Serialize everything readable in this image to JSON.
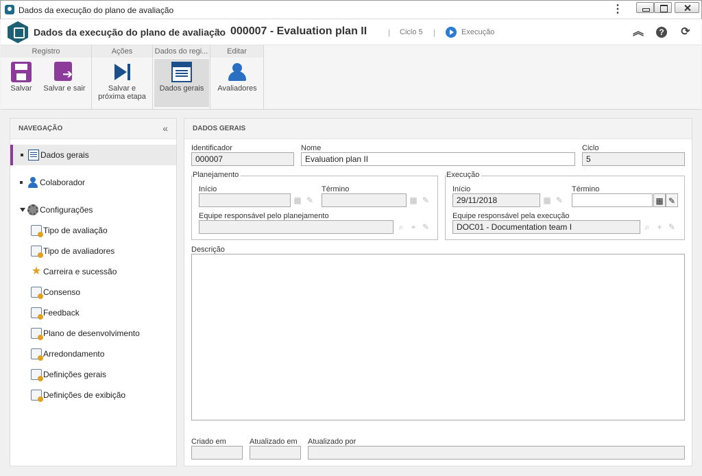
{
  "window": {
    "title": "Dados da execução do plano de avaliação"
  },
  "header": {
    "title": "Dados da execução do plano de avaliação",
    "separator": "›",
    "record": "000007 - Evaluation plan II",
    "cycle": "Ciclo 5",
    "status": "Execução"
  },
  "ribbon": {
    "groups": [
      {
        "label": "Registro",
        "buttons": [
          {
            "label": "Salvar"
          },
          {
            "label": "Salvar e sair"
          }
        ]
      },
      {
        "label": "Ações",
        "buttons": [
          {
            "label": "Salvar e próxima etapa"
          }
        ]
      },
      {
        "label": "Dados do regi...",
        "buttons": [
          {
            "label": "Dados gerais"
          }
        ]
      },
      {
        "label": "Editar",
        "buttons": [
          {
            "label": "Avaliadores"
          }
        ]
      }
    ]
  },
  "nav": {
    "heading": "NAVEGAÇÃO",
    "items": [
      {
        "label": "Dados gerais",
        "icon": "document-icon",
        "selected": true
      },
      {
        "label": "Colaborador",
        "icon": "user-icon"
      },
      {
        "label": "Configurações",
        "icon": "gear-icon",
        "expanded": true
      },
      {
        "label": "Tipo de avaliação",
        "icon": "evaluation-type-icon"
      },
      {
        "label": "Tipo de avaliadores",
        "icon": "evaluator-type-icon"
      },
      {
        "label": "Carreira e sucessão",
        "icon": "star-icon"
      },
      {
        "label": "Consenso",
        "icon": "consensus-icon"
      },
      {
        "label": "Feedback",
        "icon": "feedback-icon"
      },
      {
        "label": "Plano de desenvolvimento",
        "icon": "development-plan-icon"
      },
      {
        "label": "Arredondamento",
        "icon": "calculator-icon"
      },
      {
        "label": "Definições gerais",
        "icon": "settings-icon"
      },
      {
        "label": "Definições de exibição",
        "icon": "display-settings-icon"
      }
    ]
  },
  "main": {
    "heading": "DADOS GERAIS",
    "identifier": {
      "label": "Identificador",
      "value": "000007"
    },
    "name": {
      "label": "Nome",
      "value": "Evaluation plan II"
    },
    "cycle": {
      "label": "Ciclo",
      "value": "5"
    },
    "planning": {
      "legend": "Planejamento",
      "start_label": "Início",
      "start_value": "",
      "end_label": "Término",
      "end_value": "",
      "team_label": "Equipe responsável pelo planejamento",
      "team_value": ""
    },
    "execution": {
      "legend": "Execução",
      "start_label": "Início",
      "start_value": "29/11/2018",
      "end_label": "Término",
      "end_value": "",
      "team_label": "Equipe responsável pela execução",
      "team_value": "DOC01 - Documentation team I"
    },
    "description": {
      "label": "Descrição",
      "value": ""
    },
    "created": {
      "label": "Criado em",
      "value": ""
    },
    "updated": {
      "label": "Atualizado em",
      "value": ""
    },
    "updated_by": {
      "label": "Atualizado por",
      "value": ""
    }
  },
  "colors": {
    "accent": "#8d3b9a",
    "brand": "#1d5f73",
    "status": "#2a7bd1"
  }
}
